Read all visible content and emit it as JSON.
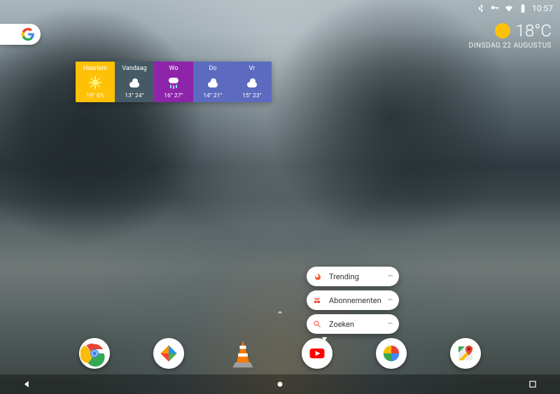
{
  "status": {
    "time": "10:57"
  },
  "weather": {
    "temp": "18°C",
    "date": "DINSDAG 22 AUGUSTUS"
  },
  "forecast": [
    {
      "label": "Haarlem",
      "temps": "19° 0%",
      "bg": "#ffc107",
      "icon": "sun"
    },
    {
      "label": "Vandaag",
      "temps": "13° 24°",
      "bg": "#455a64",
      "icon": "cloud"
    },
    {
      "label": "Wo",
      "temps": "16° 27°",
      "bg": "#8e24aa",
      "icon": "rain"
    },
    {
      "label": "Do",
      "temps": "14° 21°",
      "bg": "#5c6bc0",
      "icon": "cloud"
    },
    {
      "label": "Vr",
      "temps": "15° 23°",
      "bg": "#5c6bc0",
      "icon": "cloud"
    }
  ],
  "shortcut_menu": [
    {
      "label": "Trending",
      "icon": "fire",
      "color": "#ff5722"
    },
    {
      "label": "Abonnementen",
      "icon": "sub",
      "color": "#f44336"
    },
    {
      "label": "Zoeken",
      "icon": "search",
      "color": "#f44336"
    }
  ],
  "dock": [
    {
      "name": "chrome",
      "label": "Chrome"
    },
    {
      "name": "files",
      "label": "Files"
    },
    {
      "name": "vlc",
      "label": "VLC"
    },
    {
      "name": "youtube",
      "label": "YouTube"
    },
    {
      "name": "photos",
      "label": "Photos"
    },
    {
      "name": "maps",
      "label": "Maps"
    }
  ]
}
